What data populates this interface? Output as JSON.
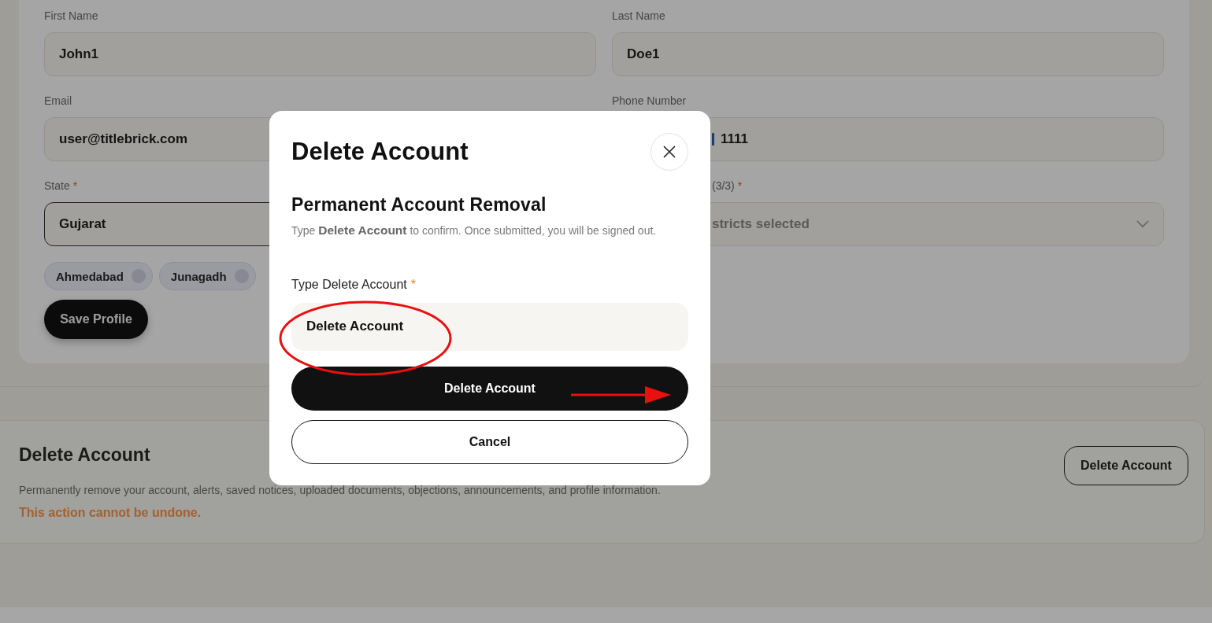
{
  "profile_form": {
    "fields": [
      {
        "kind": "text",
        "label": "First Name",
        "value": "John1"
      },
      {
        "kind": "text",
        "label": "Last Name",
        "value": "Doe1"
      },
      {
        "kind": "text",
        "label": "Email",
        "value": "user@titlebrick.com"
      },
      {
        "kind": "phone",
        "label": "Phone Number",
        "value": "1111"
      },
      {
        "kind": "text",
        "label": "State",
        "required_mark": "*",
        "value": "Gujarat",
        "focused": true
      },
      {
        "kind": "select",
        "label": "(3/3)",
        "required_mark": "*",
        "placeholder": "stricts selected"
      }
    ],
    "chips": [
      "Ahmedabad",
      "Junagadh"
    ],
    "save_button": "Save Profile"
  },
  "delete_section": {
    "title": "Delete Account",
    "description": "Permanently remove your account, alerts, saved notices, uploaded documents, objections, announcements, and profile information.",
    "warning": "This action cannot be undone.",
    "button": "Delete Account"
  },
  "dialog": {
    "title": "Delete Account",
    "subtitle": "Permanent Account Removal",
    "description": "Type **Delete Account** to confirm. Once submitted, you will be signed out.",
    "input_label": "Type Delete Account",
    "required_mark": "*",
    "input_value": "Delete Account",
    "confirm_button": "Delete Account",
    "cancel_button": "Cancel"
  },
  "annotations": {
    "highlight_ring": true,
    "pointer_arrow": true
  }
}
